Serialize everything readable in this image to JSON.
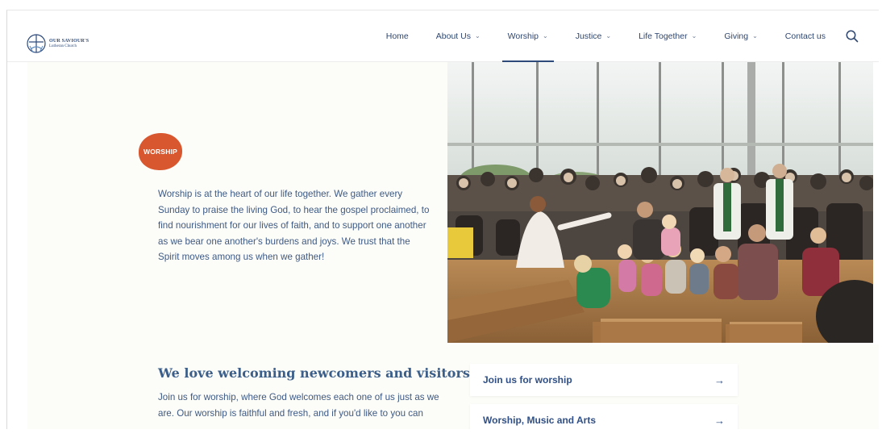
{
  "header": {
    "logo": {
      "line1": "OUR SAVIOUR'S",
      "line2": "Lutheran Church"
    },
    "nav": [
      {
        "label": "Home",
        "dropdown": false,
        "active": false
      },
      {
        "label": "About Us",
        "dropdown": true,
        "active": false
      },
      {
        "label": "Worship",
        "dropdown": true,
        "active": true
      },
      {
        "label": "Justice",
        "dropdown": true,
        "active": false
      },
      {
        "label": "Life Together",
        "dropdown": true,
        "active": false
      },
      {
        "label": "Giving",
        "dropdown": true,
        "active": false
      },
      {
        "label": "Contact us",
        "dropdown": false,
        "active": false
      }
    ],
    "search_icon": "search-icon"
  },
  "hero": {
    "badge": "WORSHIP",
    "intro": "Worship is at the heart of our life together. We gather every Sunday to praise the living God, to hear the gospel proclaimed, to find nourishment for our lives of faith, and to support one another as we bear one another's burdens and joys. We trust that the Spirit moves among us when we gather!"
  },
  "welcome": {
    "title": "We love welcoming newcomers and visitors.",
    "body": "Join us for worship, where God welcomes each one of us just as we are. Our worship is faithful and fresh, and if you'd like to you can"
  },
  "links": [
    {
      "label": "Join us for worship",
      "arrow": "→"
    },
    {
      "label": "Worship, Music and Arts",
      "arrow": "→"
    }
  ],
  "colors": {
    "accent_orange": "#d8572f",
    "brand_blue": "#2e4a7a",
    "text_blue": "#3e5a84",
    "panel_bg": "#fcfcf8"
  }
}
